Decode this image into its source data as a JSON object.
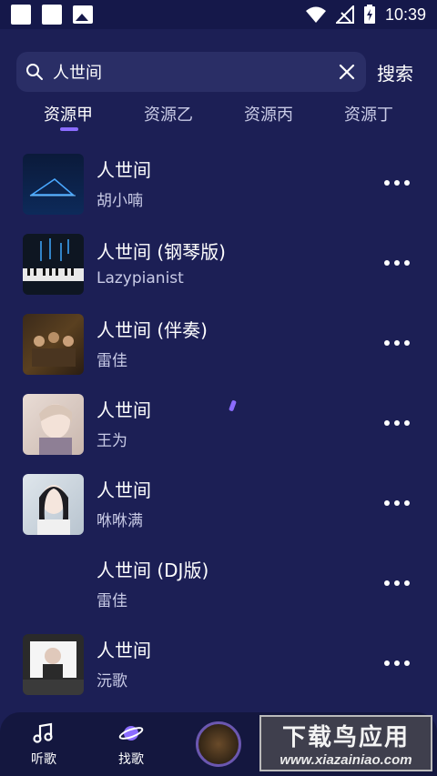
{
  "status_bar": {
    "time": "10:39",
    "icons": [
      "notification-square-icon",
      "notification-square-icon",
      "image-icon",
      "wifi-icon",
      "no-signal-icon",
      "battery-charging-icon"
    ]
  },
  "search": {
    "value": "人世间",
    "search_label": "搜索"
  },
  "tabs": [
    {
      "label": "资源甲",
      "active": true
    },
    {
      "label": "资源乙",
      "active": false
    },
    {
      "label": "资源丙",
      "active": false
    },
    {
      "label": "资源丁",
      "active": false
    }
  ],
  "songs": [
    {
      "title": "人世间",
      "artist": "胡小喃"
    },
    {
      "title": "人世间 (钢琴版)",
      "artist": "Lazypianist"
    },
    {
      "title": "人世间 (伴奏)",
      "artist": "雷佳"
    },
    {
      "title": "人世间",
      "artist": "王为"
    },
    {
      "title": "人世间",
      "artist": "咻咻满"
    },
    {
      "title": "人世间 (DJ版)",
      "artist": "雷佳"
    },
    {
      "title": "人世间",
      "artist": "沅歌"
    }
  ],
  "bottom_nav": {
    "listen_label": "听歌",
    "find_label": "找歌"
  },
  "watermark": {
    "cn": "下载鸟应用",
    "en": "www.xiazainiao.com"
  },
  "colors": {
    "background": "#1c1f55",
    "accent": "#8b6cff"
  }
}
